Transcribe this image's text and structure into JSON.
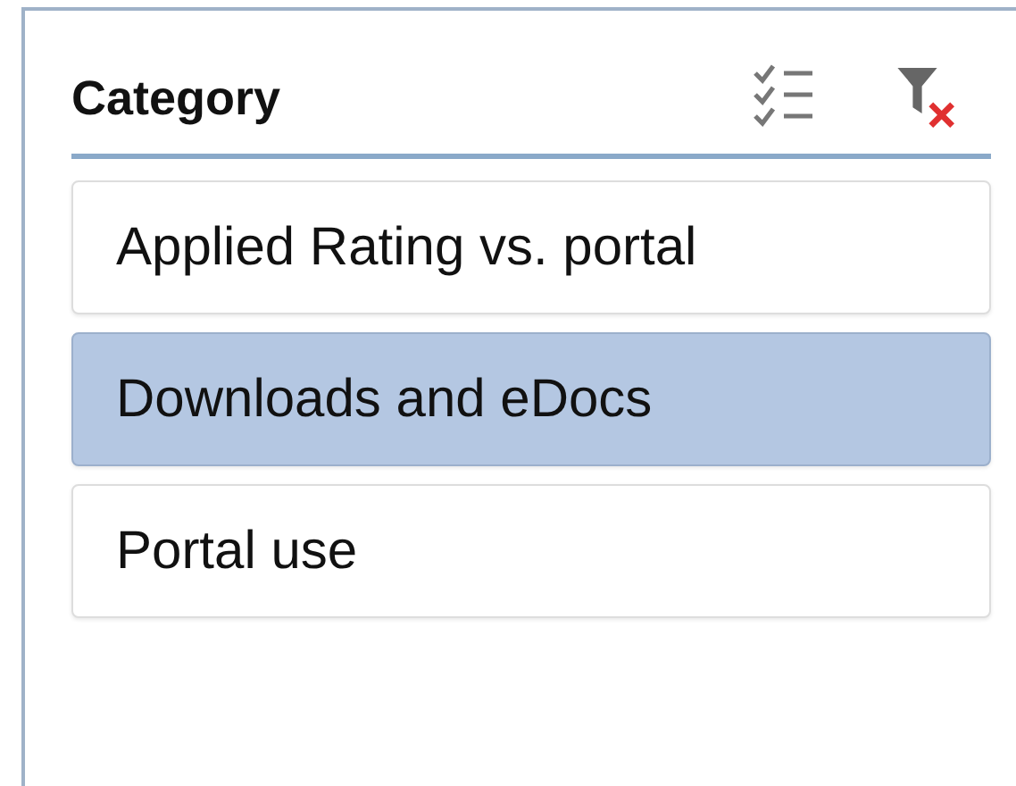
{
  "slicer": {
    "title": "Category",
    "items": [
      {
        "label": "Applied Rating vs. portal",
        "selected": false
      },
      {
        "label": "Downloads and eDocs",
        "selected": true
      },
      {
        "label": "Portal use",
        "selected": false
      }
    ]
  }
}
